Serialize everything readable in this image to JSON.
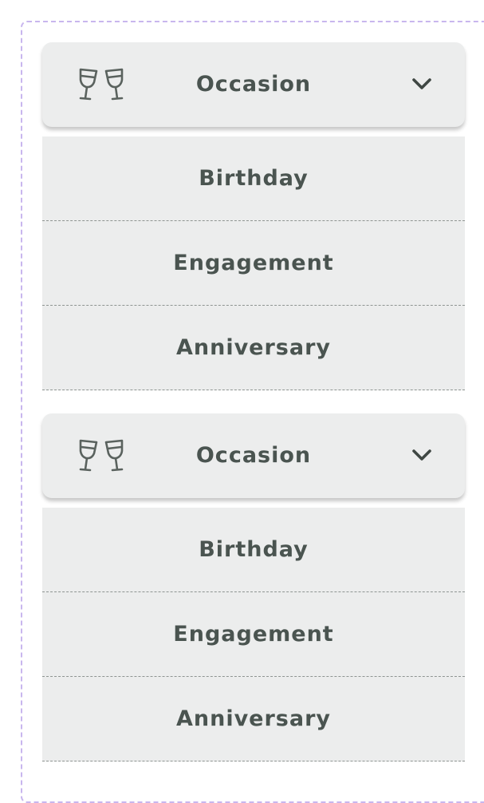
{
  "dropdowns": [
    {
      "title": "Occasion",
      "icon": "wine-glasses-icon",
      "toggle_icon": "chevron-down-icon",
      "items": [
        "Birthday",
        "Engagement",
        "Anniversary"
      ]
    },
    {
      "title": "Occasion",
      "icon": "wine-glasses-icon",
      "toggle_icon": "chevron-down-icon",
      "items": [
        "Birthday",
        "Engagement",
        "Anniversary"
      ]
    }
  ],
  "colors": {
    "surface": "#eceded",
    "text": "#4a5450",
    "frame_border": "#c8b6ee",
    "divider": "#8f9592"
  }
}
